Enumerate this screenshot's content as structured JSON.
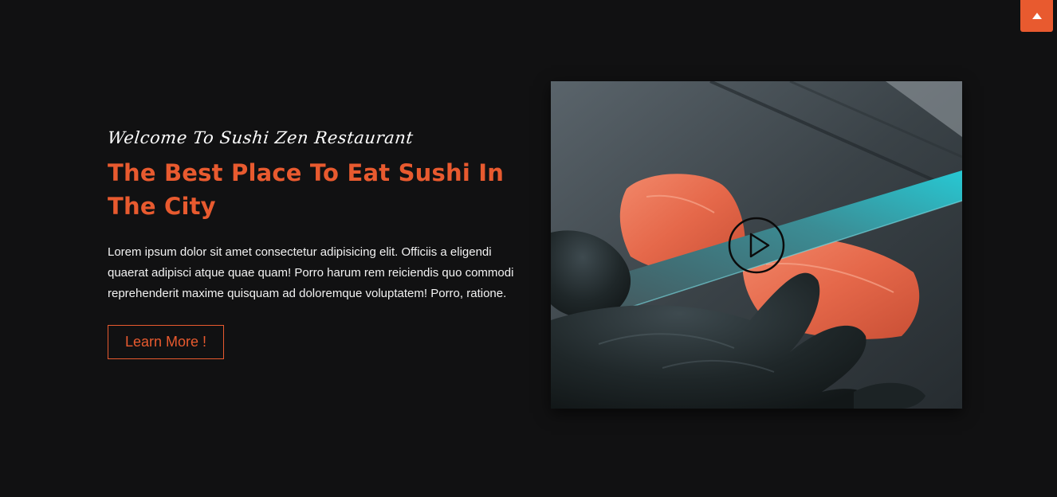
{
  "hero": {
    "subtitle": "Welcome To Sushi Zen Restaurant",
    "headline": "The Best Place To Eat Sushi In The City",
    "description": "Lorem ipsum dolor sit amet consectetur adipisicing elit. Officiis a eligendi quaerat adipisci atque quae quam! Porro harum rem reiciendis quo commodi reprehenderit maxime quisquam ad doloremque voluptatem! Porro, ratione.",
    "cta_label": "Learn More !"
  },
  "media": {
    "image_subject": "chef slicing salmon with a knife on a slate board",
    "play_icon": "play-icon"
  },
  "scroll_top": {
    "icon": "arrow-up-icon"
  },
  "colors": {
    "background": "#111112",
    "accent": "#e85a2f",
    "text": "#ffffff"
  }
}
